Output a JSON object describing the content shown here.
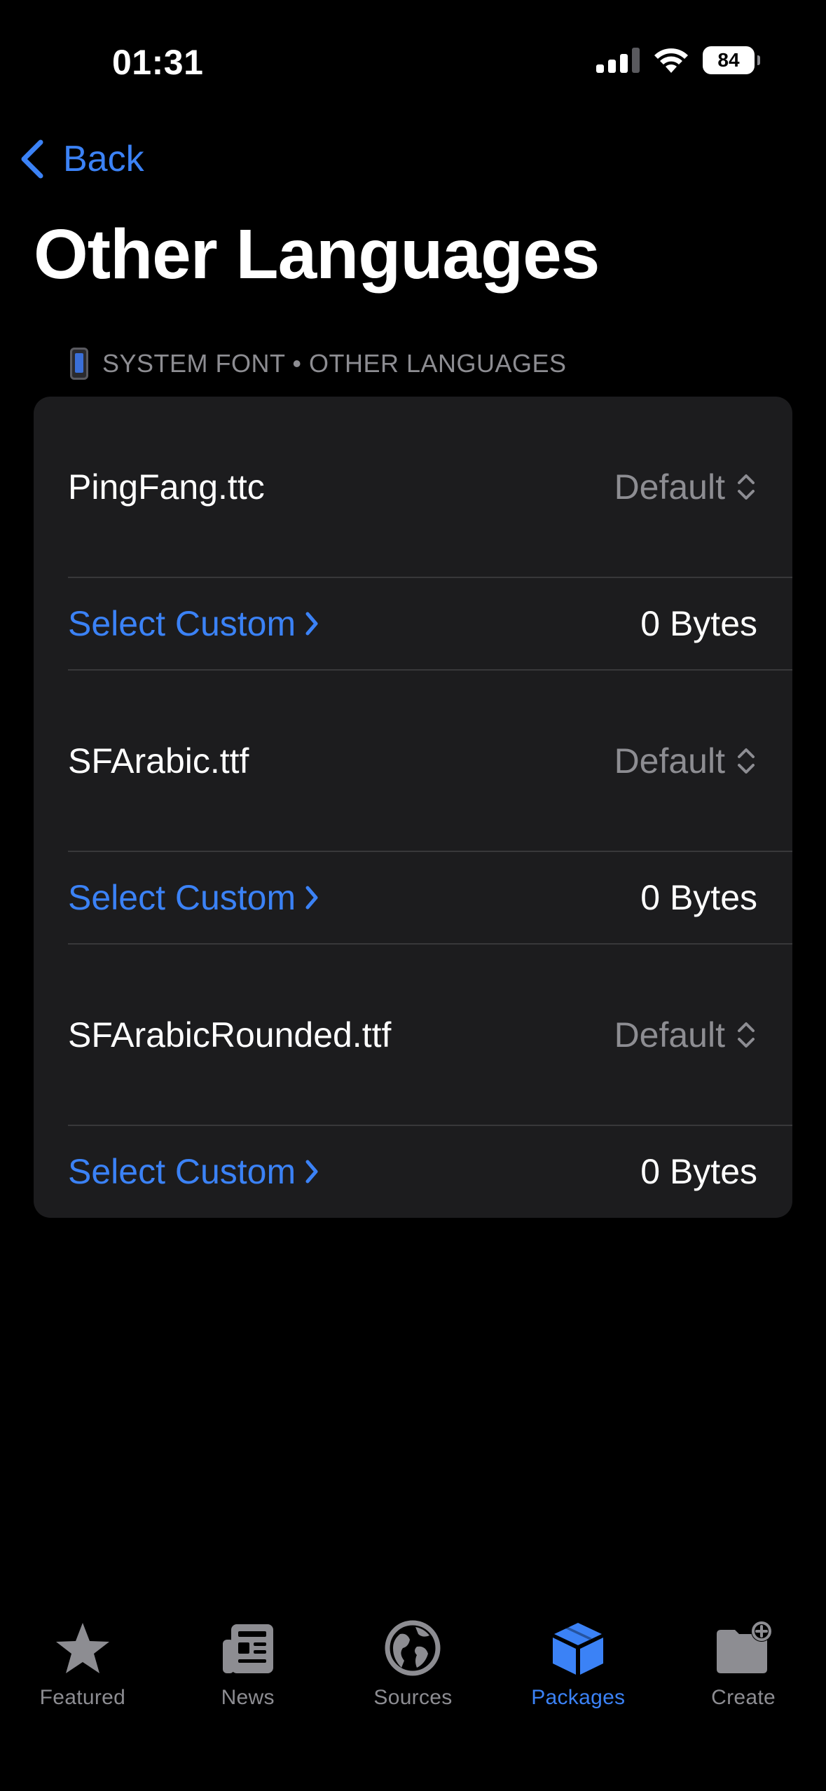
{
  "status_bar": {
    "time": "01:31",
    "battery": "84"
  },
  "nav": {
    "back_label": "Back",
    "title": "Other Languages"
  },
  "section": {
    "header": "SYSTEM FONT • OTHER LANGUAGES",
    "icon": "phone-icon"
  },
  "fonts": [
    {
      "name": "PingFang.ttc",
      "picker": "Default",
      "select_label": "Select Custom",
      "size": "0 Bytes"
    },
    {
      "name": "SFArabic.ttf",
      "picker": "Default",
      "select_label": "Select Custom",
      "size": "0 Bytes"
    },
    {
      "name": "SFArabicRounded.ttf",
      "picker": "Default",
      "select_label": "Select Custom",
      "size": "0 Bytes"
    }
  ],
  "tabs": [
    {
      "label": "Featured",
      "icon": "star-icon",
      "active": false
    },
    {
      "label": "News",
      "icon": "newspaper-icon",
      "active": false
    },
    {
      "label": "Sources",
      "icon": "globe-icon",
      "active": false
    },
    {
      "label": "Packages",
      "icon": "package-icon",
      "active": true
    },
    {
      "label": "Create",
      "icon": "folder-plus-icon",
      "active": false
    }
  ],
  "colors": {
    "accent": "#3b82f6",
    "background": "#000000",
    "card": "#1c1c1e",
    "secondary_text": "#8d8d92"
  }
}
